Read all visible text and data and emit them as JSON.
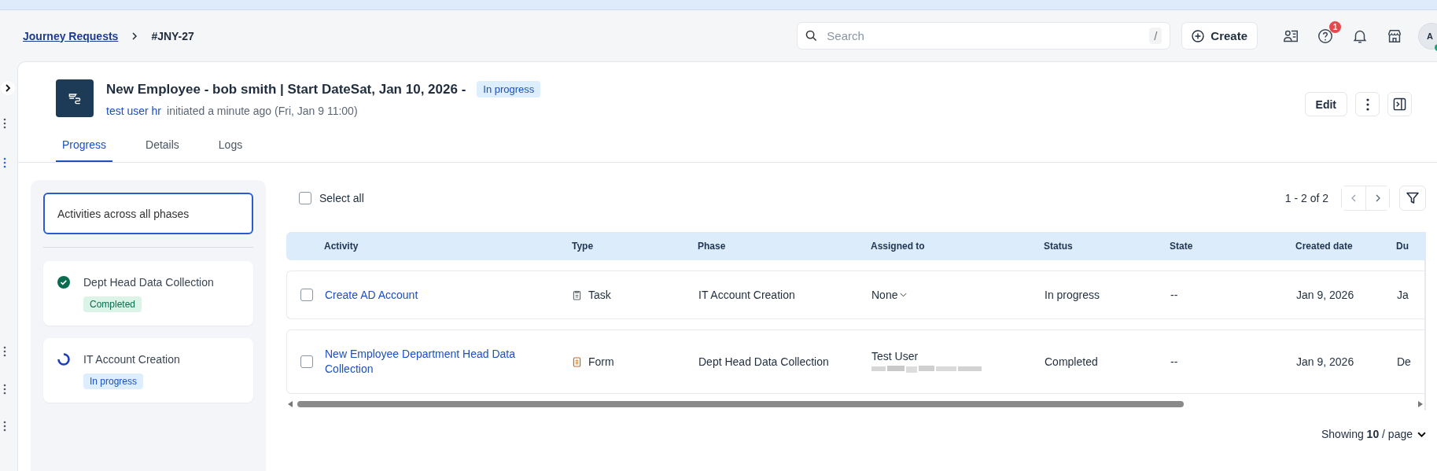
{
  "breadcrumb": [
    {
      "label": "Journey Requests",
      "kind": "link"
    },
    {
      "label": "#JNY-27",
      "kind": "current"
    }
  ],
  "search": {
    "placeholder": "Search",
    "shortcut": "/"
  },
  "create_button": "Create",
  "help_badge": "1",
  "avatar": {
    "initial": "A",
    "online": true
  },
  "request": {
    "title": "New Employee - bob smith | Start DateSat, Jan 10, 2026 -",
    "status": {
      "label": "In progress",
      "kind": "in_progress"
    },
    "initiator": "test user hr",
    "initiated": "initiated a minute ago (Fri, Jan 9 11:00)"
  },
  "edit_button": "Edit",
  "tabs": [
    {
      "label": "Progress",
      "selected": true
    },
    {
      "label": "Details",
      "selected": false
    },
    {
      "label": "Logs",
      "selected": false
    }
  ],
  "phases": {
    "all": {
      "label": "Activities across all phases",
      "selected": true
    },
    "items": [
      {
        "name": "Dept Head Data Collection",
        "status": {
          "label": "Completed",
          "kind": "completed"
        },
        "selected": false
      },
      {
        "name": "IT Account Creation",
        "status": {
          "label": "In progress",
          "kind": "in_progress"
        },
        "selected": false
      }
    ]
  },
  "table": {
    "select_all": {
      "label": "Select all",
      "checked": false
    },
    "pagination": "1 - 2 of 2",
    "columns": [
      "Activity",
      "Type",
      "Phase",
      "Assigned to",
      "Status",
      "State",
      "Created date",
      "Du"
    ],
    "rows": [
      {
        "checked": false,
        "activity": "Create AD Account",
        "type": {
          "label": "Task",
          "kind": "task"
        },
        "phase": "IT Account Creation",
        "assigned": {
          "name": "None",
          "kind": "dropdown"
        },
        "status": "In progress",
        "state": "--",
        "created": "Jan 9, 2026",
        "column_9": "Ja"
      },
      {
        "checked": false,
        "activity": "New Employee Department Head Data Collection",
        "type": {
          "label": "Form",
          "kind": "form"
        },
        "phase": "Dept Head Data Collection",
        "assigned": {
          "name": "Test User",
          "kind": "redacted"
        },
        "status": "Completed",
        "state": "--",
        "created": "Jan 9, 2026",
        "column_9": "De"
      }
    ]
  },
  "page_size": "Showing **10** / page"
}
